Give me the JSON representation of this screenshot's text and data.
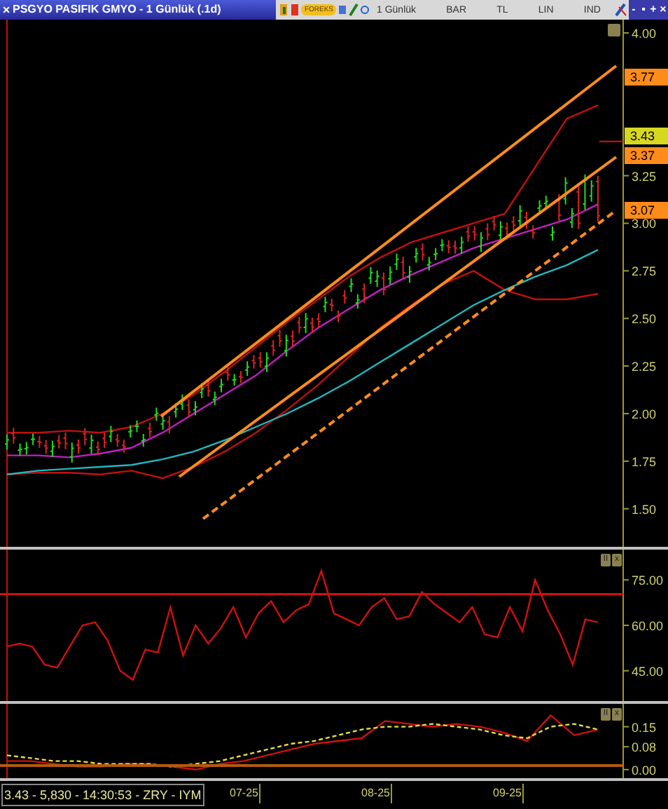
{
  "window": {
    "close": "×",
    "title": "PSGYO PASIFIK GMYO - 1 Günlük (.1d)",
    "logo": "FOREKS",
    "menus": [
      "1 Günlük",
      "BAR",
      "TL",
      "LIN",
      "IND"
    ],
    "controls": [
      "-",
      "▪",
      "+",
      "×"
    ]
  },
  "price_pane": {
    "price_tags": [
      {
        "label": "3.77",
        "color": "#ff8c1a"
      },
      {
        "label": "3.43",
        "color": "#d8d820"
      },
      {
        "label": "3.37",
        "color": "#ff8c1a"
      },
      {
        "label": "3.07",
        "color": "#ff8c1a"
      }
    ],
    "chart_data": {
      "type": "line",
      "ylim": [
        1.3,
        4.07
      ],
      "yticks": [
        {
          "value": 4.0,
          "label": "4.00"
        },
        {
          "value": 3.25,
          "label": "3.25"
        },
        {
          "value": 3.0,
          "label": "3.00"
        },
        {
          "value": 2.75,
          "label": "2.75"
        },
        {
          "value": 2.5,
          "label": "2.50"
        },
        {
          "value": 2.25,
          "label": "2.25"
        },
        {
          "value": 2.0,
          "label": "2.00"
        },
        {
          "value": 1.75,
          "label": "1.75"
        },
        {
          "value": 1.5,
          "label": "1.50"
        }
      ],
      "series": [
        {
          "color": "#c01010",
          "values": [
            1.9,
            1.9,
            1.91,
            1.9,
            1.93,
            2.0,
            2.1,
            2.22,
            2.35,
            2.48,
            2.6,
            2.72,
            2.82,
            2.9,
            2.95,
            3.0,
            3.05,
            3.3,
            3.55,
            3.62
          ]
        },
        {
          "color": "#c01010",
          "values": [
            1.68,
            1.69,
            1.69,
            1.68,
            1.7,
            1.66,
            1.72,
            1.8,
            1.9,
            2.02,
            2.15,
            2.3,
            2.45,
            2.57,
            2.68,
            2.75,
            2.65,
            2.6,
            2.6,
            2.63
          ]
        },
        {
          "color": "#c020c0",
          "values": [
            1.78,
            1.78,
            1.77,
            1.79,
            1.82,
            1.9,
            2.0,
            2.1,
            2.2,
            2.33,
            2.45,
            2.55,
            2.65,
            2.73,
            2.8,
            2.87,
            2.92,
            2.97,
            3.02,
            3.1
          ]
        },
        {
          "color": "#20b8c0",
          "values": [
            1.68,
            1.7,
            1.71,
            1.72,
            1.73,
            1.76,
            1.8,
            1.86,
            1.93,
            2.0,
            2.08,
            2.17,
            2.27,
            2.37,
            2.47,
            2.57,
            2.65,
            2.72,
            2.78,
            2.86
          ]
        }
      ]
    }
  },
  "rsi_pane": {
    "buttons": [
      "II",
      "x"
    ],
    "chart_data": {
      "type": "line",
      "ylim": [
        35,
        85
      ],
      "yticks": [
        {
          "value": 75,
          "label": "75.00"
        },
        {
          "value": 60,
          "label": "60.00"
        },
        {
          "value": 45,
          "label": "45.00"
        }
      ],
      "series": [
        {
          "color": "#d01010",
          "values": [
            53,
            54,
            53,
            47,
            46,
            53,
            60,
            61,
            55,
            45,
            42,
            52,
            51,
            66,
            50,
            60,
            54,
            59,
            66,
            56,
            64,
            68,
            61,
            65,
            67,
            78,
            64,
            62,
            60,
            66,
            69,
            62,
            63,
            71,
            67,
            64,
            61,
            66,
            57,
            56,
            66,
            58,
            75,
            65,
            57,
            47,
            62,
            61
          ]
        }
      ]
    }
  },
  "macd_pane": {
    "buttons": [
      "II",
      "x"
    ],
    "chart_data": {
      "type": "line",
      "ylim": [
        -0.03,
        0.23
      ],
      "yticks": [
        {
          "value": 0.15,
          "label": "0.15"
        },
        {
          "value": 0.08,
          "label": "0.08"
        },
        {
          "value": 0.0,
          "label": "0.00"
        }
      ],
      "series": [
        {
          "color": "#d01010",
          "values": [
            0.03,
            0.03,
            0.02,
            0.01,
            0.01,
            0.02,
            0.02,
            0.01,
            0.0,
            0.02,
            0.03,
            0.05,
            0.07,
            0.09,
            0.1,
            0.11,
            0.17,
            0.16,
            0.15,
            0.16,
            0.15,
            0.13,
            0.1,
            0.19,
            0.12,
            0.14
          ]
        },
        {
          "color": "#e0e040",
          "line_style": "dashed",
          "values": [
            0.05,
            0.04,
            0.03,
            0.03,
            0.02,
            0.02,
            0.02,
            0.01,
            0.02,
            0.03,
            0.05,
            0.07,
            0.09,
            0.1,
            0.12,
            0.14,
            0.15,
            0.15,
            0.16,
            0.15,
            0.14,
            0.12,
            0.11,
            0.15,
            0.16,
            0.14
          ]
        }
      ]
    }
  },
  "status_bar": {
    "quote": "3.43 - 5,830 - 14:30:53 - ZRY - IYM",
    "dates": [
      "07-25",
      "08-25",
      "09-25"
    ]
  }
}
